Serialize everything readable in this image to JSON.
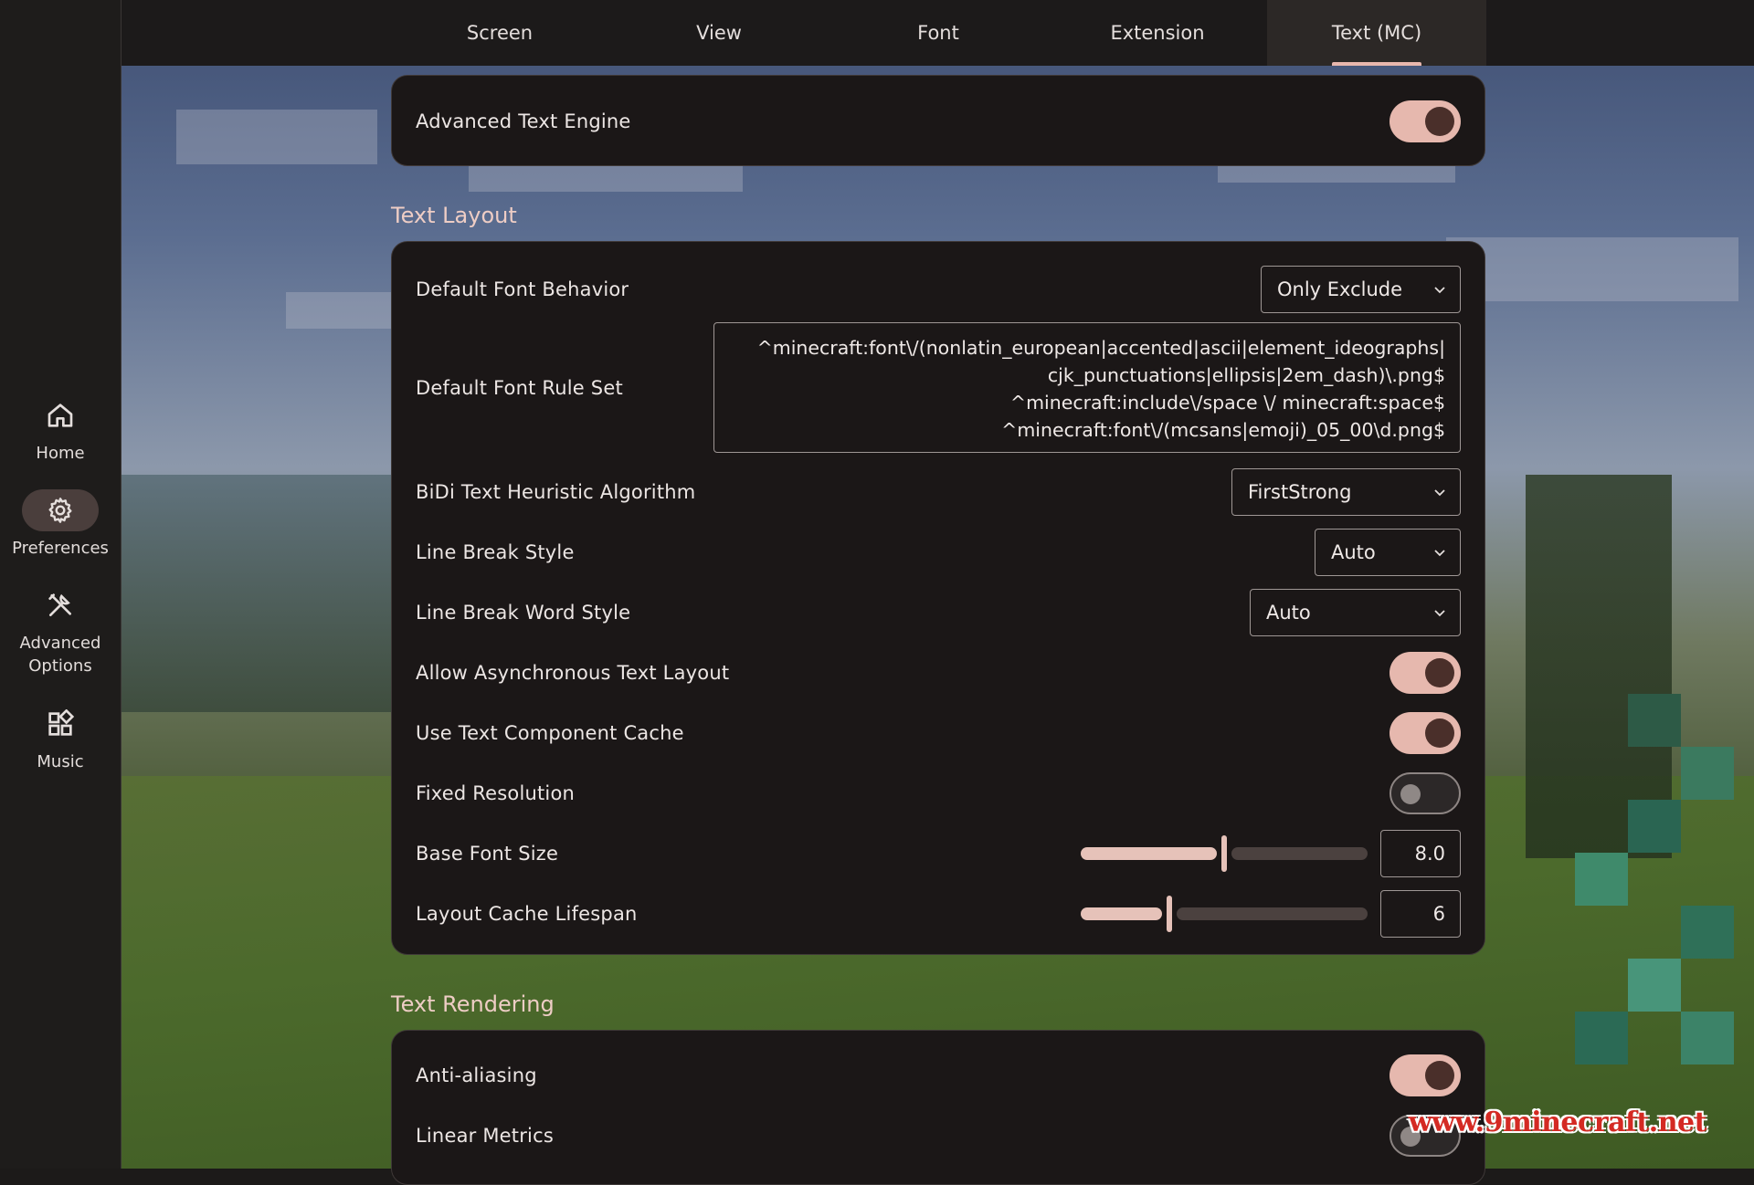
{
  "sidebar": {
    "items": [
      {
        "label": "Home",
        "icon": "home-icon",
        "active": false
      },
      {
        "label": "Preferences",
        "icon": "gear-icon",
        "active": true
      },
      {
        "label": "Advanced\nOptions",
        "icon": "tools-icon",
        "active": false
      },
      {
        "label": "Music",
        "icon": "grid-icon",
        "active": false
      }
    ]
  },
  "tabs": [
    {
      "label": "Screen",
      "active": false
    },
    {
      "label": "View",
      "active": false
    },
    {
      "label": "Font",
      "active": false
    },
    {
      "label": "Extension",
      "active": false
    },
    {
      "label": "Text (MC)",
      "active": true
    }
  ],
  "top_card": {
    "advanced_text_engine": {
      "label": "Advanced Text Engine",
      "on": true
    }
  },
  "text_layout": {
    "title": "Text Layout",
    "default_font_behavior": {
      "label": "Default Font Behavior",
      "value": "Only Exclude"
    },
    "default_font_rule_set": {
      "label": "Default Font Rule Set",
      "lines": [
        "^minecraft:font\\/(nonlatin_european|accented|ascii|element_ideographs|",
        "cjk_punctuations|ellipsis|2em_dash)\\.png$",
        "^minecraft:include\\/space \\/ minecraft:space$",
        "^minecraft:font\\/(mcsans|emoji)_05_00\\d.png$"
      ]
    },
    "bidi": {
      "label": "BiDi Text Heuristic Algorithm",
      "value": "FirstStrong"
    },
    "line_break_style": {
      "label": "Line Break Style",
      "value": "Auto"
    },
    "line_break_word_style": {
      "label": "Line Break Word Style",
      "value": "Auto"
    },
    "async_layout": {
      "label": "Allow Asynchronous Text Layout",
      "on": true
    },
    "component_cache": {
      "label": "Use Text Component Cache",
      "on": true
    },
    "fixed_resolution": {
      "label": "Fixed Resolution",
      "on": false
    },
    "base_font_size": {
      "label": "Base Font Size",
      "value": "8.0",
      "fraction": 0.5
    },
    "layout_cache_lifespan": {
      "label": "Layout Cache Lifespan",
      "value": "6",
      "fraction": 0.31
    }
  },
  "text_rendering": {
    "title": "Text Rendering",
    "anti_aliasing": {
      "label": "Anti-aliasing",
      "on": true
    },
    "linear_metrics": {
      "label": "Linear Metrics",
      "on": false
    }
  },
  "watermark": "www.9minecraft.net",
  "colors": {
    "accent": "#e6b8ae",
    "card_bg": "#1b1717",
    "watermark": "#d42a23"
  }
}
